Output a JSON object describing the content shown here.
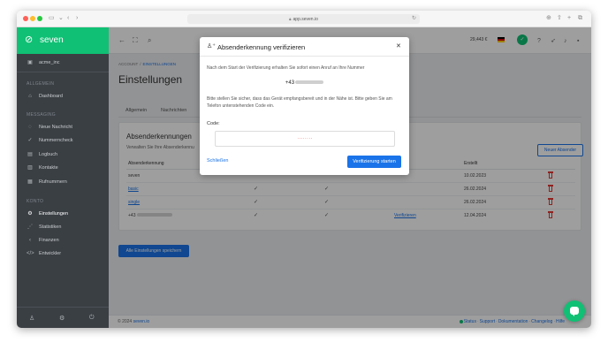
{
  "browser": {
    "url": "app.seven.io"
  },
  "sidebar": {
    "brand": "seven",
    "account": "acme_inc",
    "sections": {
      "general": "ALLGEMEIN",
      "messaging": "MESSAGING",
      "account": "KONTO"
    },
    "items": [
      {
        "label": "Dashboard",
        "icon": "home-icon"
      },
      {
        "label": "Neue Nachricht",
        "icon": "message-icon"
      },
      {
        "label": "Nummerncheck",
        "icon": "check-icon"
      },
      {
        "label": "Logbuch",
        "icon": "book-icon"
      },
      {
        "label": "Kontakte",
        "icon": "contacts-icon"
      },
      {
        "label": "Rufnummern",
        "icon": "phone-icon"
      },
      {
        "label": "Einstellungen",
        "icon": "gear-icon",
        "active": true
      },
      {
        "label": "Statistiken",
        "icon": "chart-icon"
      },
      {
        "label": "Finanzen",
        "icon": "finance-icon"
      },
      {
        "label": "Entwickler",
        "icon": "code-icon"
      }
    ]
  },
  "header": {
    "credit": "29,443 €"
  },
  "main": {
    "breadcrumb": [
      "ACCOUNT",
      "EINSTELLUNGEN"
    ],
    "title": "Einstellungen",
    "tabs": [
      "Allgemein",
      "Nachrichten"
    ],
    "card": {
      "title": "Absenderkennungen",
      "desc": "Verwalten Sie Ihre Absenderkennu",
      "new_button": "Neuer Absender",
      "columns": [
        "Absenderkennung",
        "Erstellt"
      ],
      "rows": [
        {
          "sender": "seven",
          "link": false,
          "created": "10.02.2023",
          "check1": false,
          "check2": false,
          "verify": ""
        },
        {
          "sender": "basic",
          "link": true,
          "created": "26.02.2024",
          "check1": true,
          "check2": true,
          "verify": ""
        },
        {
          "sender": "single",
          "link": true,
          "created": "26.02.2024",
          "check1": true,
          "check2": true,
          "verify": ""
        },
        {
          "sender": "+43",
          "link": false,
          "created": "12.04.2024",
          "check1": true,
          "check2": true,
          "verify": "Verifizieren"
        }
      ]
    },
    "save_button": "Alle Einstellungen speichern",
    "footer": {
      "copy_prefix": "© 2024",
      "copy_brand": "seven.io",
      "links": [
        "Status",
        "Support",
        "Dokumentation",
        "Changelog",
        "Hilfe"
      ]
    }
  },
  "modal": {
    "title": "Absenderkennung verifizieren",
    "text1": "Nach dem Start der Verifizierung erhalten Sie sofort einen Anruf an Ihre Nummer",
    "phone_prefix": "+43",
    "text2": "Bitte stellen Sie sicher, dass das Gerät empfangsbereit und in der Nähe ist. Bitte geben Sie am Telefon untenstehenden Code ein.",
    "code_label": "Code:",
    "code_value": "········",
    "cancel": "Schließen",
    "start": "Verifizierung starten"
  },
  "colors": {
    "brand": "#10c074",
    "primary": "#1a73e8",
    "danger": "#e53935"
  }
}
